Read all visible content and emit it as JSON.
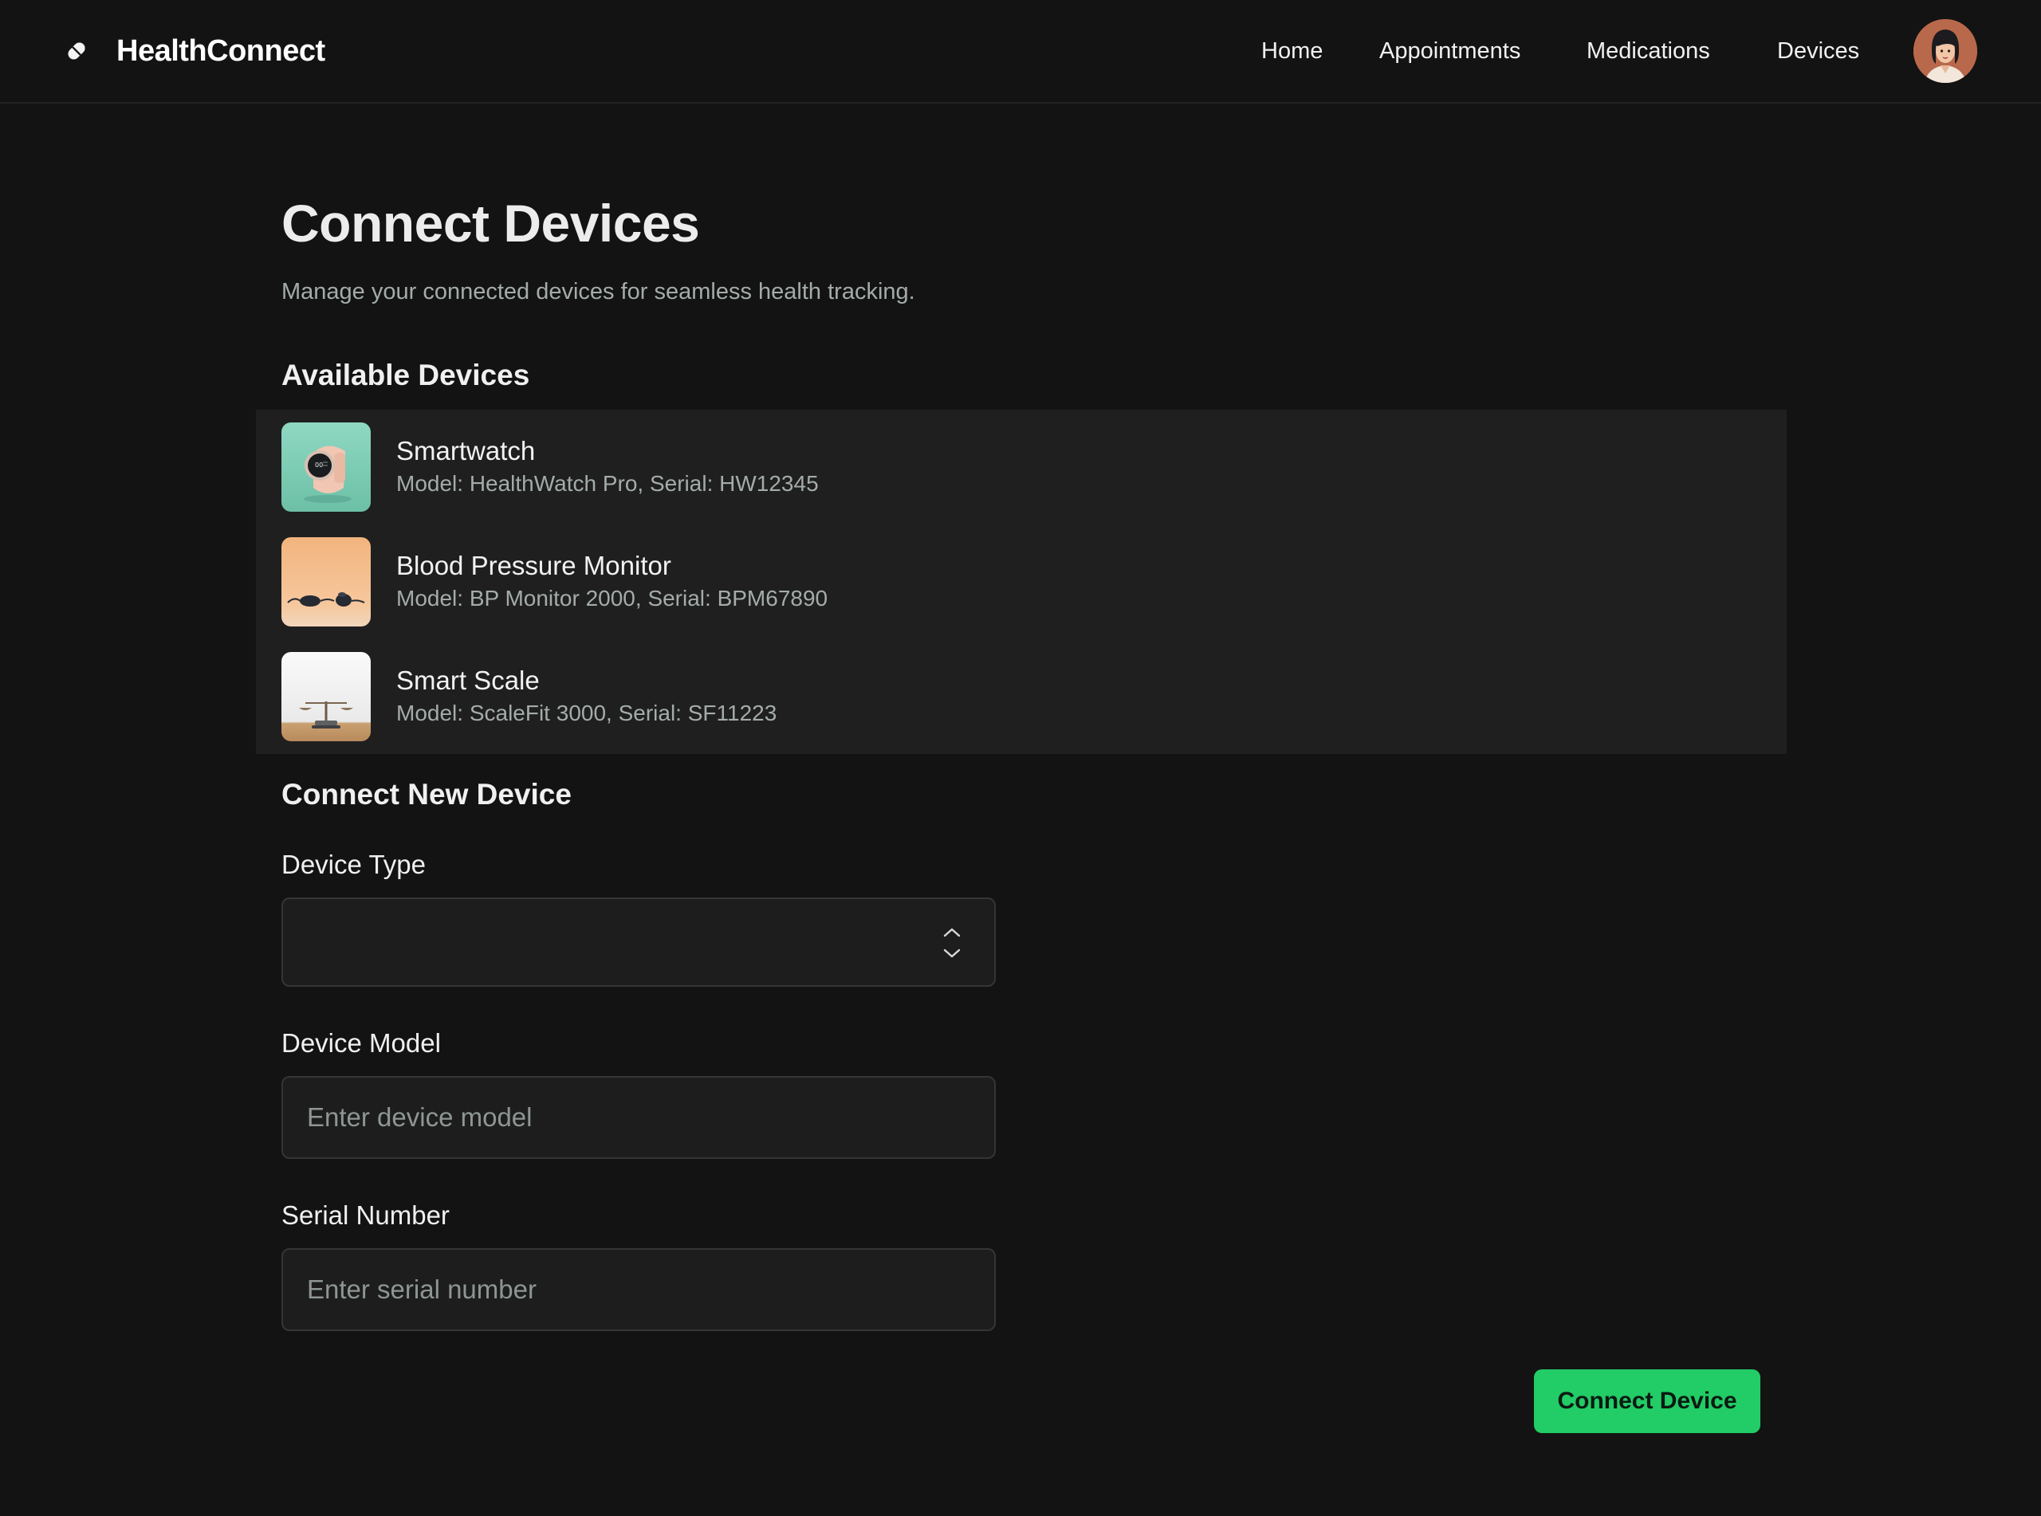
{
  "app": {
    "brand_name": "HealthConnect",
    "brand_icon": "pill-icon",
    "accent_color": "#22cc66"
  },
  "nav": {
    "items": [
      {
        "label": "Home"
      },
      {
        "label": "Appointments"
      },
      {
        "label": "Medications"
      },
      {
        "label": "Devices"
      }
    ],
    "avatar": "user-avatar"
  },
  "page": {
    "title": "Connect Devices",
    "subtitle": "Manage your connected devices for seamless health tracking."
  },
  "available_devices": {
    "heading": "Available Devices",
    "items": [
      {
        "name": "Smartwatch",
        "meta": "Model: HealthWatch Pro, Serial: HW12345",
        "thumb": "smartwatch-image"
      },
      {
        "name": "Blood Pressure Monitor",
        "meta": "Model: BP Monitor 2000, Serial: BPM67890",
        "thumb": "blood-pressure-monitor-image"
      },
      {
        "name": "Smart Scale",
        "meta": "Model: ScaleFit 3000, Serial: SF11223",
        "thumb": "smart-scale-image"
      }
    ]
  },
  "connect_form": {
    "heading": "Connect New Device",
    "device_type": {
      "label": "Device Type",
      "value": ""
    },
    "device_model": {
      "label": "Device Model",
      "placeholder": "Enter device model",
      "value": ""
    },
    "serial_number": {
      "label": "Serial Number",
      "placeholder": "Enter serial number",
      "value": ""
    },
    "submit_label": "Connect Device"
  }
}
